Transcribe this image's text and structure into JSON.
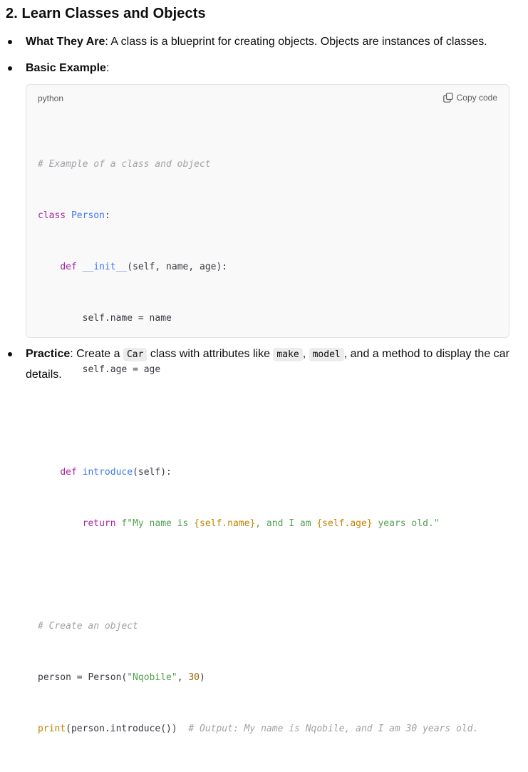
{
  "heading": "2. Learn Classes and Objects",
  "bullets": {
    "what_label": "What They Are",
    "what_text": ": A class is a blueprint for creating objects. Objects are instances of classes.",
    "basic_label": "Basic Example",
    "basic_text": ":",
    "practice_label": "Practice",
    "practice_pre": ": Create a ",
    "practice_code1": "Car",
    "practice_mid1": " class with attributes like ",
    "practice_code2": "make",
    "practice_sep": ", ",
    "practice_code3": "model",
    "practice_post": ", and a method to display the car details."
  },
  "codeblock": {
    "language": "python",
    "copy_label": "Copy code",
    "copy_icon": "copy-icon",
    "tokens": {
      "c1": "# Example of a class and object",
      "class_kw": "class",
      "class_name": "Person",
      "colon": ":",
      "def_kw": "def",
      "init_name": "__init__",
      "init_args": "(self, name, age):",
      "self_name": "self.name = name",
      "self_age": "self.age = age",
      "intro_name": "introduce",
      "intro_args": "(self):",
      "return_kw": "return",
      "f_str_a": "f\"My name is ",
      "interp1": "{self.name}",
      "f_str_b": ", and I am ",
      "interp2": "{self.age}",
      "f_str_c": " years old.\"",
      "c2": "# Create an object",
      "person_assign": "person = Person(",
      "arg_str": "\"Nqobile\"",
      "arg_sep": ", ",
      "arg_num": "30",
      "close_paren": ")",
      "print_kw": "print",
      "print_args": "(person.introduce())",
      "c3": "# Output: My name is Nqobile, and I am 30 years old."
    }
  }
}
